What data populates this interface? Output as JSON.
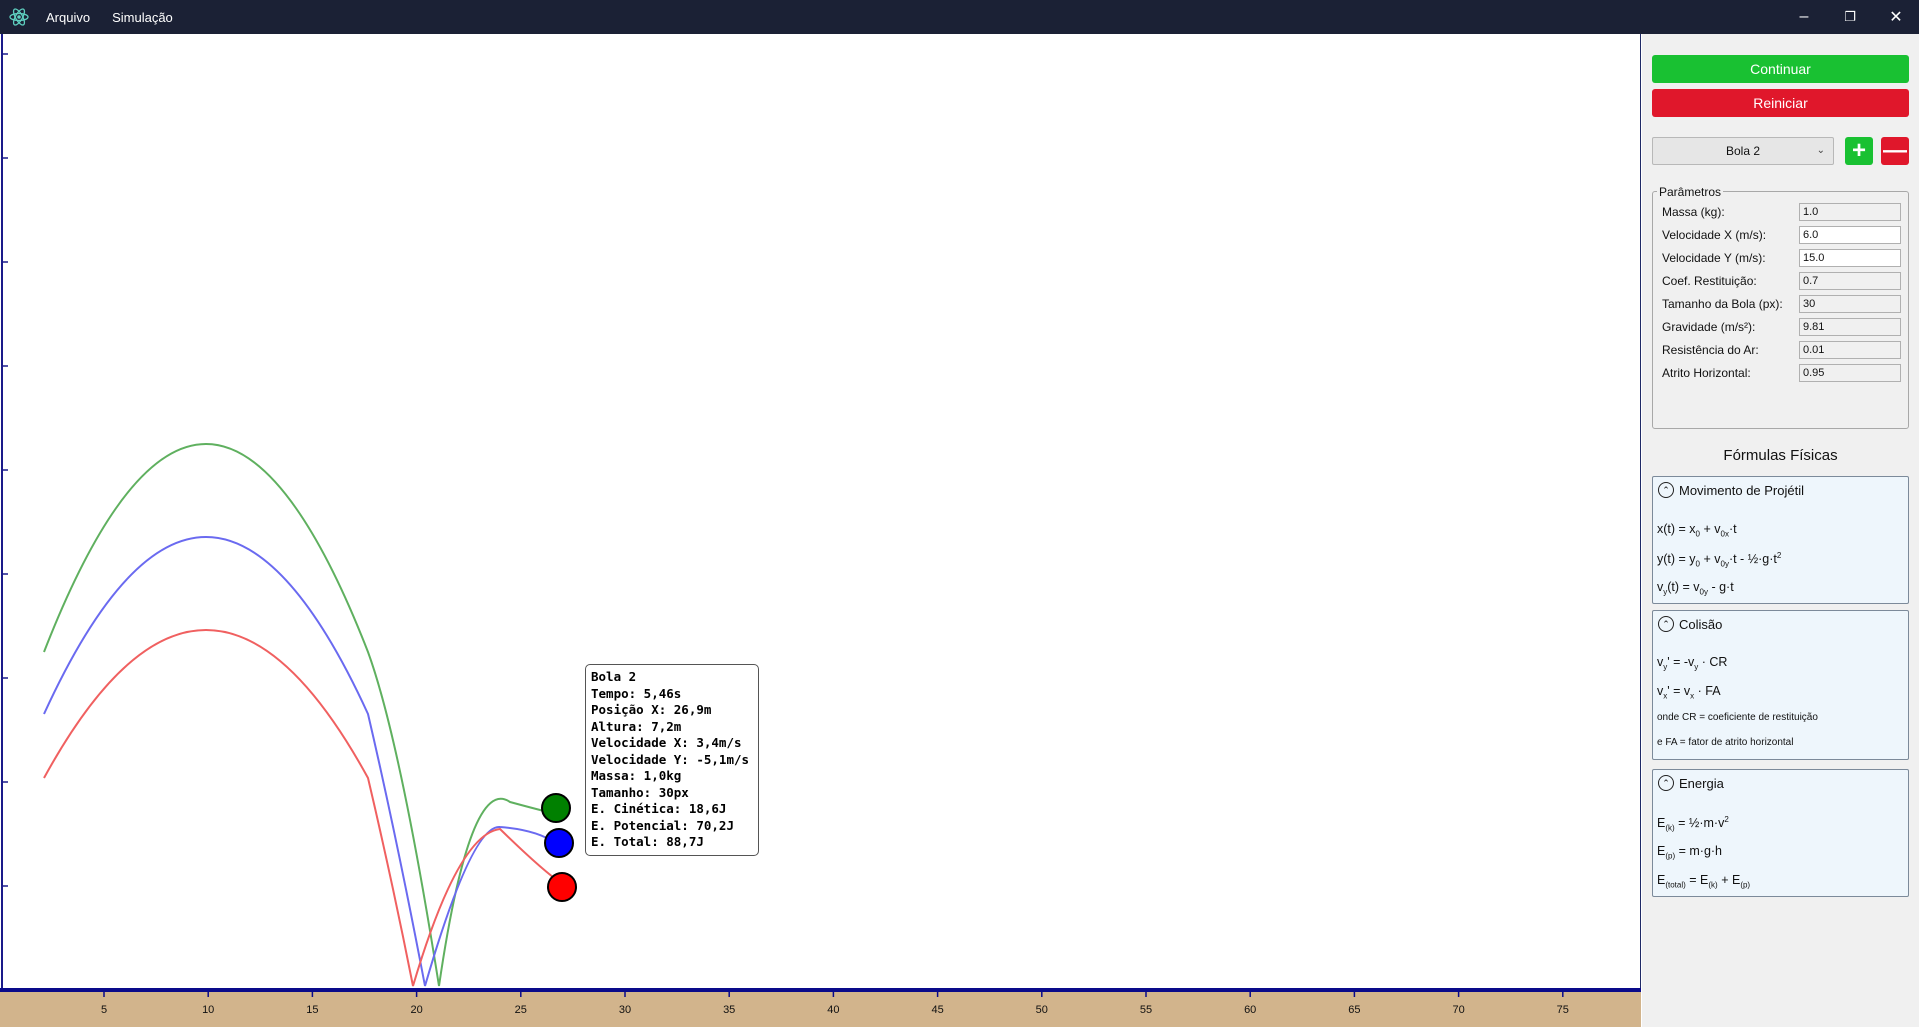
{
  "titlebar": {
    "menu": [
      "Arquivo",
      "Simulação"
    ],
    "controls": {
      "minimize": "–",
      "restore": "❐",
      "close": "✕"
    }
  },
  "canvas": {
    "x_ticks": [
      "5",
      "10",
      "15",
      "20",
      "25",
      "30",
      "35",
      "40",
      "45",
      "50",
      "55",
      "60",
      "65",
      "70",
      "75"
    ],
    "colors": {
      "ground": "#d2b48c",
      "axis": "#0a0a8a",
      "green": "#0b8f0b",
      "blue": "#0000ff",
      "red": "#ff0000"
    }
  },
  "info_box": {
    "lines": [
      "Bola 2",
      "Tempo: 5,46s",
      "Posição X: 26,9m",
      "Altura: 7,2m",
      "Velocidade X: 3,4m/s",
      "Velocidade Y: -5,1m/s",
      "Massa: 1,0kg",
      "Tamanho: 30px",
      "E. Cinética: 18,6J",
      "E. Potencial: 70,2J",
      "E. Total: 88,7J"
    ]
  },
  "panel": {
    "continue_label": "Continuar",
    "restart_label": "Reiniciar",
    "ball_select": "Bola 2",
    "add_label": "+",
    "remove_label": "—",
    "params_title": "Parâmetros",
    "params": [
      {
        "label": "Massa (kg):",
        "value": "1.0"
      },
      {
        "label": "Velocidade X (m/s):",
        "value": "6.0"
      },
      {
        "label": "Velocidade Y (m/s):",
        "value": "15.0"
      },
      {
        "label": "Coef. Restituição:",
        "value": "0.7"
      },
      {
        "label": "Tamanho da Bola (px):",
        "value": "30"
      },
      {
        "label": "Gravidade (m/s²):",
        "value": "9.81"
      },
      {
        "label": "Resistência do Ar:",
        "value": "0.01"
      },
      {
        "label": "Atrito Horizontal:",
        "value": "0.95"
      }
    ],
    "formulas_title": "Fórmulas Físicas",
    "sections": {
      "projectile": {
        "title": "Movimento de Projétil"
      },
      "collision": {
        "title": "Colisão",
        "note1": "onde CR = coeficiente de restituição",
        "note2": "e FA = fator de atrito horizontal"
      },
      "energy": {
        "title": "Energia"
      }
    }
  }
}
